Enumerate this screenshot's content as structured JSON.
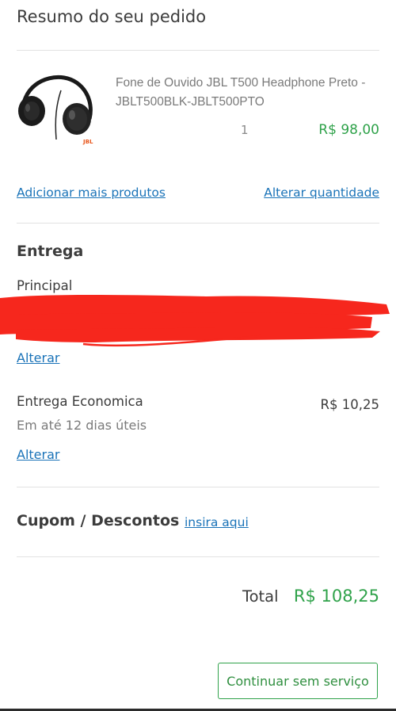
{
  "summary": {
    "title": "Resumo do seu pedido"
  },
  "product": {
    "name": "Fone de Ouvido JBL T500 Headphone Preto - JBLT500BLK-JBLT500PTO",
    "quantity": "1",
    "price": "R$ 98,00",
    "brand_mark": "JBL"
  },
  "actions": {
    "add_more": "Adicionar mais produtos",
    "change_quantity": "Alterar quantidade"
  },
  "delivery": {
    "heading": "Entrega",
    "address_label": "Principal",
    "change_address": "Alterar",
    "method": "Entrega Economica",
    "method_price": "R$ 10,25",
    "eta": "Em até 12 dias úteis",
    "change_method": "Alterar"
  },
  "coupon": {
    "heading": "Cupom / Descontos",
    "insert_link": "insira aqui"
  },
  "total": {
    "label": "Total",
    "value": "R$ 108,25"
  },
  "continue_button": "Continuar sem serviço",
  "colors": {
    "accent_green": "#2fa24a",
    "link_blue": "#1a73b8",
    "redaction_red": "#f6271d"
  },
  "icons": [
    "headphone-product-image"
  ]
}
